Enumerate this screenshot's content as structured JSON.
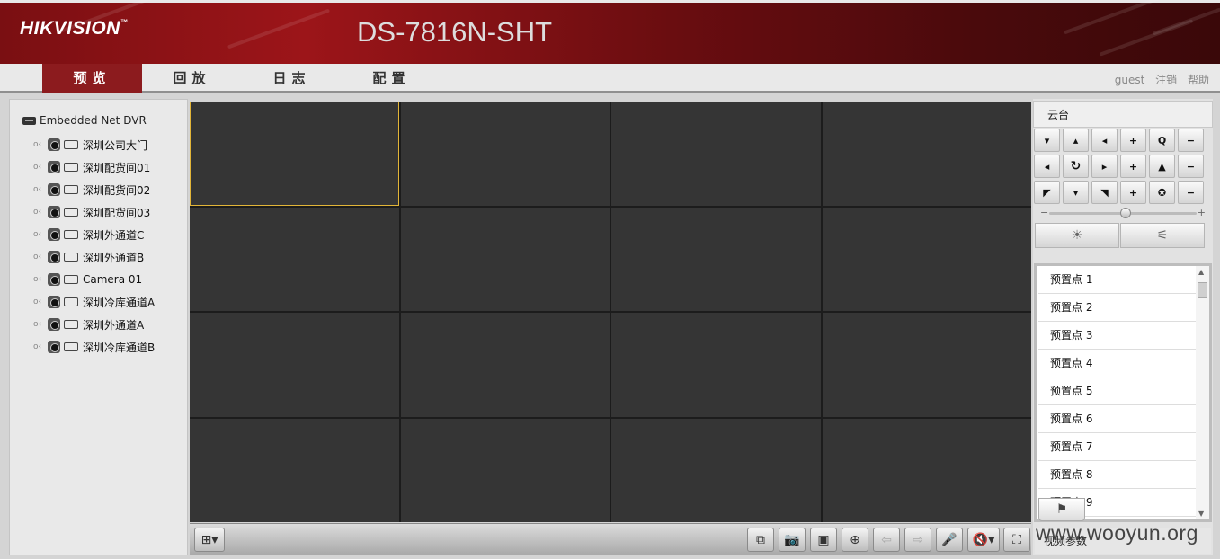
{
  "header": {
    "logo": "HIKVISION",
    "tm": "™",
    "model": "DS-7816N-SHT"
  },
  "nav": {
    "tabs": [
      {
        "label": "预览",
        "active": true
      },
      {
        "label": "回放",
        "active": false
      },
      {
        "label": "日志",
        "active": false
      },
      {
        "label": "配置",
        "active": false
      }
    ],
    "user": "guest",
    "logout": "注销",
    "help": "帮助"
  },
  "tree": {
    "root": "Embedded Net DVR",
    "channels": [
      "深圳公司大门",
      "深圳配货间01",
      "深圳配货间02",
      "深圳配货间03",
      "深圳外通道C",
      "深圳外通道B",
      "Camera 01",
      "深圳冷库通道A",
      "深圳外通道A",
      "深圳冷库通道B"
    ]
  },
  "ptz": {
    "title": "云台",
    "buttons": [
      [
        "▾",
        "▴",
        "◂",
        "+",
        "zoom-icon",
        "−"
      ],
      [
        "◂",
        "refresh-icon",
        "▸",
        "+",
        "focus-icon",
        "−"
      ],
      [
        "◤",
        "▾",
        "◥",
        "+",
        "iris-icon",
        "−"
      ]
    ],
    "speed_level": 0.52,
    "presets": [
      "预置点 1",
      "预置点 2",
      "预置点 3",
      "预置点 4",
      "预置点 5",
      "预置点 6",
      "预置点 7",
      "预置点 8",
      "预置点 9"
    ],
    "video_params": "视频参数"
  },
  "toolbar": {
    "buttons": [
      "multi-window-icon",
      "snapshot-icon",
      "record-icon",
      "digital-zoom-icon",
      "prev-icon",
      "next-icon",
      "microphone-icon",
      "volume-icon",
      "fullscreen-icon"
    ]
  },
  "watermark": "www.wooyun.org",
  "colors": {
    "header": "#8c1b1e",
    "active_tab": "#8c1b1e",
    "selected_cell": "#e2b538",
    "video_cell": "#353535"
  }
}
